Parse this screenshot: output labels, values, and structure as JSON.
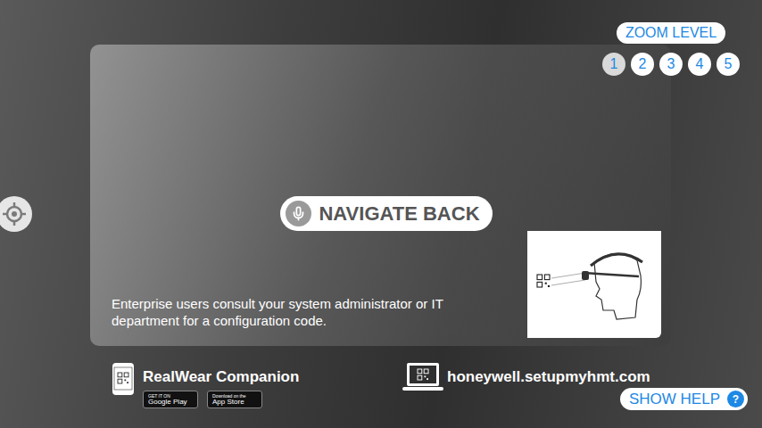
{
  "zoom": {
    "label": "ZOOM LEVEL",
    "levels": [
      {
        "label": "1",
        "selected": true
      },
      {
        "label": "2",
        "selected": false
      },
      {
        "label": "3",
        "selected": false
      },
      {
        "label": "4",
        "selected": false
      },
      {
        "label": "5",
        "selected": false
      }
    ]
  },
  "voice_command": {
    "label": "NAVIGATE BACK"
  },
  "message": "Enterprise users consult your system administrator or IT department for a configuration code.",
  "companion": {
    "title": "RealWear Companion",
    "stores": [
      {
        "small": "GET IT ON",
        "name": "Google Play"
      },
      {
        "small": "Download on the",
        "name": "App Store"
      }
    ]
  },
  "website": "honeywell.setupmyhmt.com",
  "help": {
    "label": "SHOW HELP",
    "badge": "?"
  }
}
